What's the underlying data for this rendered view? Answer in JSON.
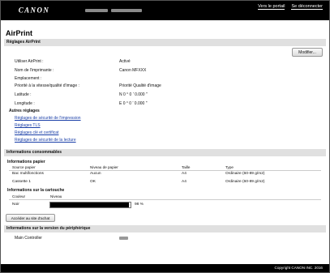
{
  "header": {
    "logo_alt": "CANON",
    "links": [
      "Vers le portail",
      "Se déconnecter"
    ]
  },
  "page_title": "AirPrint",
  "airprint_settings": {
    "section_title": "Réglages AirPrint",
    "modify_label": "Modifier...",
    "rows": [
      {
        "label": "Utiliser AirPrint :",
        "value": "Activé"
      },
      {
        "label": "Nom de l'imprimante :",
        "value": "Canon MFXXX"
      },
      {
        "label": "Emplacement :",
        "value": ""
      },
      {
        "label": "Priorité à la vitesse/qualité d'image :",
        "value": "Priorité Qualité d'image"
      },
      {
        "label": "Latitude :",
        "value": "N 0 ° 0 ' 0.000 \""
      },
      {
        "label": "Longitude :",
        "value": "E 0 ° 0 ' 0.000 \""
      }
    ],
    "other_settings_title": "Autres réglages",
    "links": [
      "Réglages de sécurité de l'impression",
      "Réglages TLS",
      "Réglages clé et certificat",
      "Réglages de sécurité de la lecture"
    ]
  },
  "consumables": {
    "section_title": "Informations consommables",
    "paper_title": "Informations papier",
    "paper_headers": [
      "Source papier",
      "Niveau de papier",
      "Taille",
      "Type"
    ],
    "paper_rows": [
      [
        "Bac multifonctions",
        "Aucun",
        "A4",
        "Ordinaire (60-89 g/m2)"
      ],
      [
        "Cassette 1",
        "OK",
        "A4",
        "Ordinaire (60-89 g/m2)"
      ]
    ],
    "cartridge_title": "Informations sur la cartouche",
    "cartridge_headers": [
      "Couleur",
      "Niveau"
    ],
    "cartridge_rows": [
      {
        "color": "Noir",
        "level_percent": 98,
        "level_label": "98 %"
      }
    ],
    "access_button": "Accéder au site d'achat"
  },
  "version": {
    "section_title": "Informations sur la version du périphérique",
    "rows": [
      {
        "label": "Main Controller"
      }
    ]
  },
  "footer": {
    "copyright": "Copyright CANON INC. 2016"
  }
}
